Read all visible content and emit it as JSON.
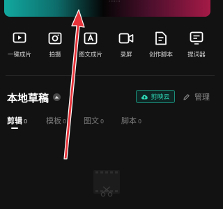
{
  "banner": {
    "caption": "·······"
  },
  "tools": [
    {
      "label": "一键成片",
      "icon": "play-icon"
    },
    {
      "label": "拍摄",
      "icon": "camera-icon"
    },
    {
      "label": "图文成片",
      "icon": "image-text-icon"
    },
    {
      "label": "录屏",
      "icon": "video-record-icon"
    },
    {
      "label": "创作脚本",
      "icon": "script-icon"
    },
    {
      "label": "提词器",
      "icon": "teleprompter-icon"
    }
  ],
  "drafts": {
    "title": "本地草稿",
    "cloud_label": "剪映云",
    "manage_label": "管理",
    "tabs": [
      {
        "label": "剪辑",
        "count": "0"
      },
      {
        "label": "模板",
        "count": "0"
      },
      {
        "label": "图文",
        "count": "0"
      },
      {
        "label": "脚本",
        "count": "0"
      }
    ]
  },
  "colors": {
    "accent": "#2ed3b2",
    "annotation_arrow": "#e8333a",
    "background": "#121212"
  }
}
